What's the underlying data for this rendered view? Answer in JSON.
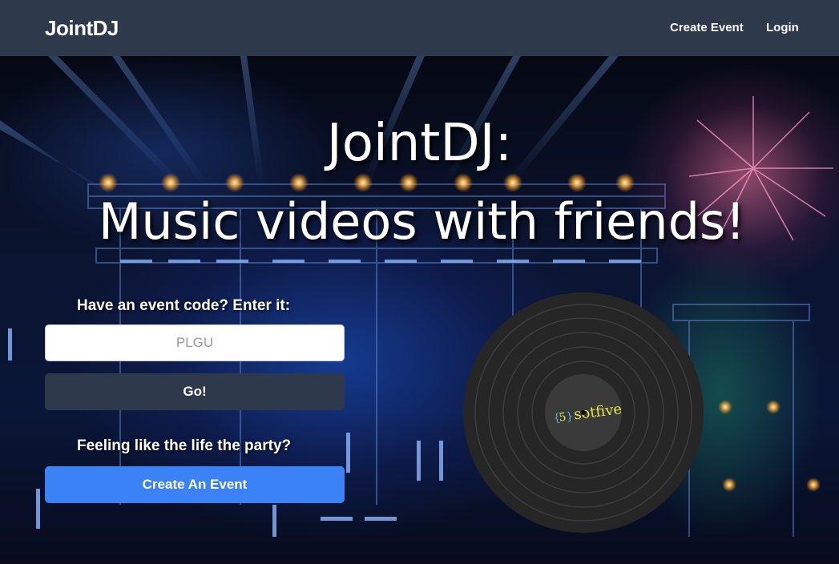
{
  "navbar": {
    "brand": "JointDJ",
    "links": {
      "create_event": "Create Event",
      "login": "Login"
    },
    "bg_color": "#2e3a4c"
  },
  "hero": {
    "title_line1": "JointDJ:",
    "title_line2": "Music videos with friends!",
    "code_prompt": "Have an event code? Enter it:",
    "code_input": {
      "value": "",
      "placeholder": "PLGU"
    },
    "go_button": "Go!",
    "party_prompt": "Feeling like the life the party?",
    "create_button": "Create An Event",
    "accent_color": "#3b82f6"
  },
  "record": {
    "label_logo_text": "sotfive",
    "label_logo_digit": "5",
    "label_logo_braces": [
      "{",
      "}"
    ]
  }
}
